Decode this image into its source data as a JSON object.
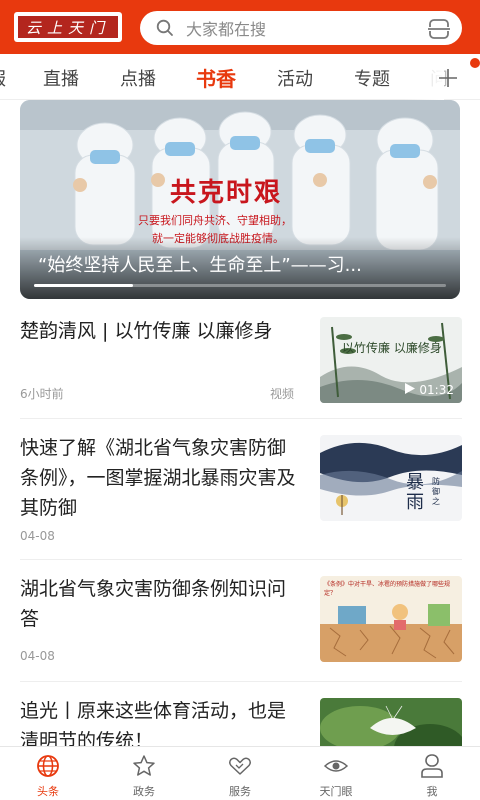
{
  "header": {
    "logo_text": "云上天门",
    "search_placeholder": "大家都在搜",
    "brand_color": "#e8390e"
  },
  "tabs": {
    "items": [
      {
        "label": "服"
      },
      {
        "label": "直播"
      },
      {
        "label": "点播"
      },
      {
        "label": "书香",
        "active": true
      },
      {
        "label": "活动"
      },
      {
        "label": "专题"
      },
      {
        "label": "问"
      }
    ],
    "more_icon": "plus-icon"
  },
  "banner": {
    "title": "“始终坚持人民至上、生命至上”——习...",
    "overlay_headline": "共克时艰",
    "overlay_line1": "只要我们同舟共济、守望相助，",
    "overlay_line2": "就一定能够彻底战胜疫情。",
    "progress": 0.24
  },
  "news": [
    {
      "title": "楚韵清风 | 以竹传廉 以廉修身",
      "time": "6小时前",
      "source": "视频",
      "duration": "01:32",
      "thumb_text": "以竹传廉 以廉修身",
      "thumb_icon": "play-icon"
    },
    {
      "title": "快速了解《湖北省气象灾害防御条例》，一图掌握湖北暴雨灾害及其防御",
      "time": "04-08",
      "thumb_text": "暴雨",
      "thumb_sub": "防御之"
    },
    {
      "title": "湖北省气象灾害防御条例知识问答",
      "time": "04-08",
      "thumb_text": "《条例》中对干旱、冰雹的预防措施做了哪些规定？"
    },
    {
      "title": "追光丨原来这些体育活动，也是清明节的传统！",
      "time": ""
    }
  ],
  "bottom_nav": [
    {
      "label": "头条",
      "icon": "globe-icon",
      "active": true
    },
    {
      "label": "政务",
      "icon": "star-icon"
    },
    {
      "label": "服务",
      "icon": "handshake-icon"
    },
    {
      "label": "天门眼",
      "icon": "eye-icon"
    },
    {
      "label": "我",
      "icon": "user-icon"
    }
  ]
}
